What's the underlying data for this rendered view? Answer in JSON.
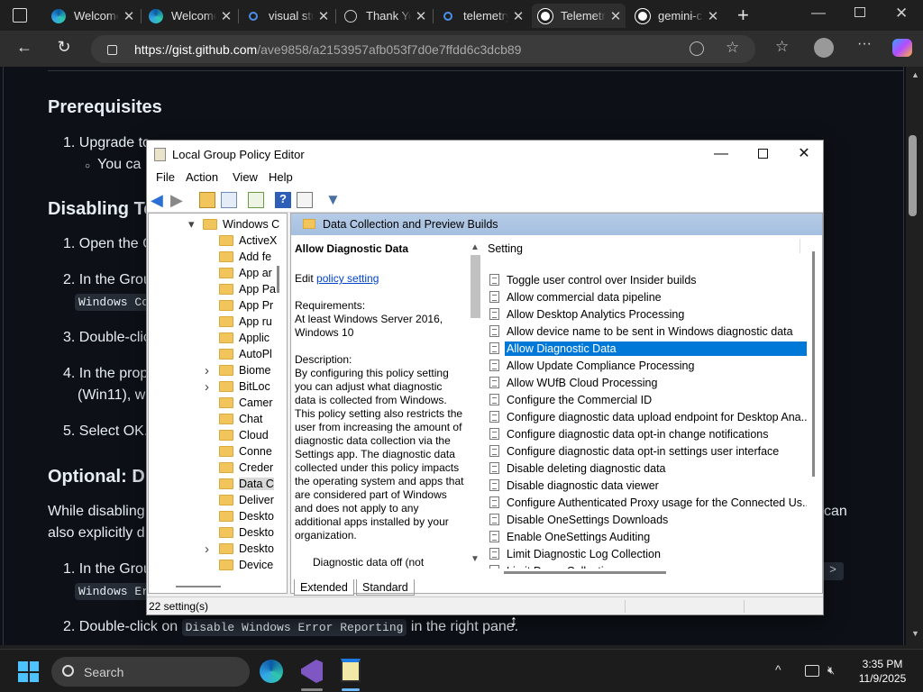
{
  "browser": {
    "tabs": [
      {
        "title": "Welcome",
        "icon": "edge-icon"
      },
      {
        "title": "Welcome",
        "icon": "edge-icon"
      },
      {
        "title": "visual studio",
        "icon": "search-icon"
      },
      {
        "title": "Thank You",
        "icon": "globe-icon"
      },
      {
        "title": "telemetry",
        "icon": "search-icon"
      },
      {
        "title": "Telemetry",
        "icon": "github-icon",
        "active": true
      },
      {
        "title": "gemini-cli",
        "icon": "github-icon"
      }
    ],
    "url_host": "https://gist.github.com",
    "url_path": "/ave9858/a2153957afb053f7d0e7ffdd6c3dcb89"
  },
  "article": {
    "h_prereq": "Prerequisites",
    "p1": "1. Upgrade to",
    "p1b": "You ca",
    "h_disabling": "Disabling Te",
    "p2": "1. Open the G",
    "p3": "2. In the Grou",
    "code1": "Windows Co",
    "p4": "3. Double-clic",
    "p5": "4. In the prop",
    "p5b": "(Win11), wh",
    "p6": "5. Select OK.",
    "h_optional": "Optional: Di",
    "p7": "While disabling",
    "p7b": "can",
    "p7c": "also explicitly d",
    "p8": "1. In the Grou",
    "code2": "Windows Err",
    "p9a": "2. Double-click on",
    "code3": "Disable Windows Error Reporting",
    "p9b": "in the right pane."
  },
  "gpe": {
    "title": "Local Group Policy Editor",
    "menu": [
      "File",
      "Action",
      "View",
      "Help"
    ],
    "tree": [
      {
        "label": "Windows C",
        "expanded": true,
        "level": 0
      },
      {
        "label": "ActiveX",
        "level": 1
      },
      {
        "label": "Add fe",
        "level": 1
      },
      {
        "label": "App ar",
        "level": 1
      },
      {
        "label": "App Pa",
        "level": 1
      },
      {
        "label": "App Pr",
        "level": 1
      },
      {
        "label": "App ru",
        "level": 1
      },
      {
        "label": "Applic",
        "level": 1
      },
      {
        "label": "AutoPl",
        "level": 1
      },
      {
        "label": "Biome",
        "level": 1,
        "expander": true
      },
      {
        "label": "BitLoc",
        "level": 1,
        "expander": true
      },
      {
        "label": "Camer",
        "level": 1
      },
      {
        "label": "Chat",
        "level": 1
      },
      {
        "label": "Cloud",
        "level": 1
      },
      {
        "label": "Conne",
        "level": 1
      },
      {
        "label": "Creder",
        "level": 1
      },
      {
        "label": "Data C",
        "level": 1,
        "selected": true
      },
      {
        "label": "Deliver",
        "level": 1
      },
      {
        "label": "Deskto",
        "level": 1
      },
      {
        "label": "Deskto",
        "level": 1
      },
      {
        "label": "Deskto",
        "level": 1,
        "expander": true
      },
      {
        "label": "Device",
        "level": 1
      }
    ],
    "folder_header": "Data Collection and Preview Builds",
    "desc_title": "Allow Diagnostic Data",
    "edit_prefix": "Edit",
    "edit_link": "policy setting",
    "requirements_label": "Requirements:",
    "requirements": "At least Windows Server 2016, Windows 10",
    "description_label": "Description:",
    "description": "By configuring this policy setting you can adjust what diagnostic data is collected from Windows. This policy setting also restricts the user from increasing the amount of diagnostic data collection via the Settings app. The diagnostic data collected under this policy impacts the operating system and apps that are considered part of Windows and does not apply to any additional apps installed by your organization.",
    "desc_tail": "Diagnostic data off (not",
    "column_header": "Setting",
    "settings": [
      "Toggle user control over Insider builds",
      "Allow commercial data pipeline",
      "Allow Desktop Analytics Processing",
      "Allow device name to be sent in Windows diagnostic data",
      "Allow Diagnostic Data",
      "Allow Update Compliance Processing",
      "Allow WUfB Cloud Processing",
      "Configure the Commercial ID",
      "Configure diagnostic data upload endpoint for Desktop Ana...",
      "Configure diagnostic data opt-in change notifications",
      "Configure diagnostic data opt-in settings user interface",
      "Disable deleting diagnostic data",
      "Disable diagnostic data viewer",
      "Configure Authenticated Proxy usage for the Connected Us...",
      "Disable OneSettings Downloads",
      "Enable OneSettings Auditing",
      "Limit Diagnostic Log Collection",
      "Limit Dump Collection"
    ],
    "selected_setting": 4,
    "tab_extended": "Extended",
    "tab_standard": "Standard",
    "status": "22 setting(s)"
  },
  "taskbar": {
    "search_label": "Search",
    "time": "3:35 PM",
    "date": "11/9/2025"
  }
}
